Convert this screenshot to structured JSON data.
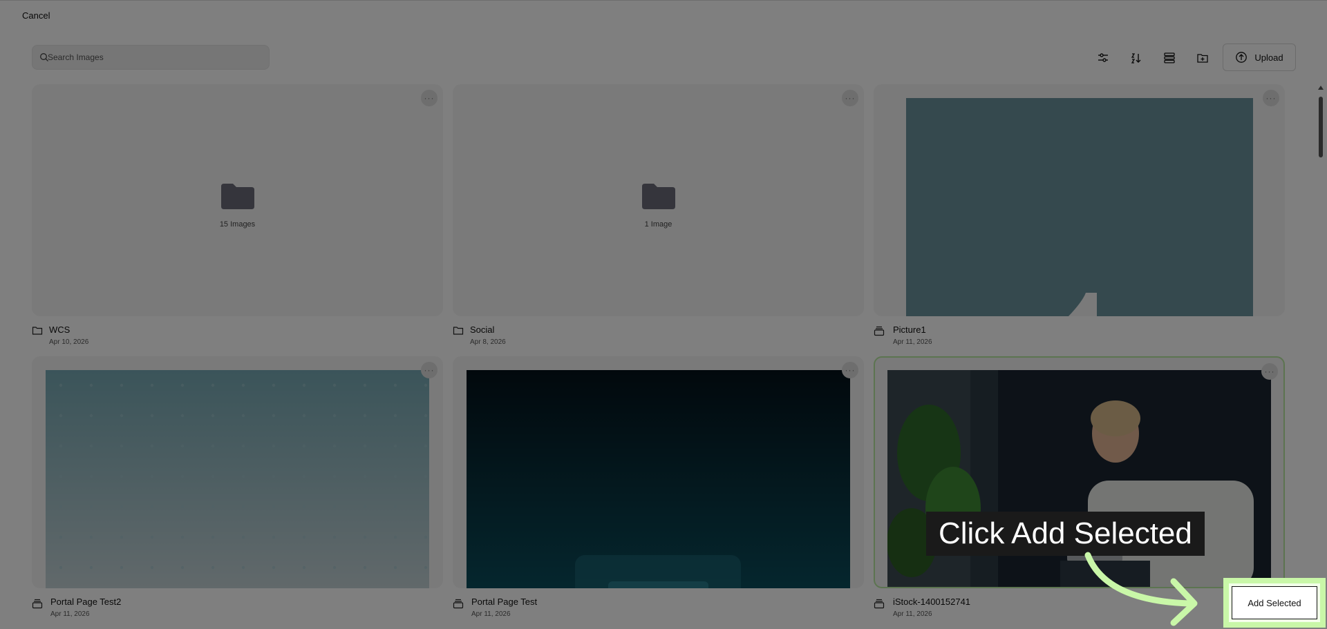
{
  "header": {
    "cancel_label": "Cancel"
  },
  "search": {
    "placeholder": "Search Images"
  },
  "toolbar": {
    "icons": [
      "filter-icon",
      "sort-az-icon",
      "list-view-icon",
      "new-folder-icon"
    ],
    "upload_label": "Upload"
  },
  "items": [
    {
      "type": "folder",
      "name": "WCS",
      "date": "Apr 10, 2026",
      "count": "15 Images"
    },
    {
      "type": "folder",
      "name": "Social",
      "date": "Apr 8, 2026",
      "count": "1 Image"
    },
    {
      "type": "image",
      "name": "Picture1",
      "date": "Apr 11, 2026"
    },
    {
      "type": "image",
      "name": "Portal Page Test2",
      "date": "Apr 11, 2026"
    },
    {
      "type": "image",
      "name": "Portal Page Test",
      "date": "Apr 11, 2026"
    },
    {
      "type": "image",
      "name": "iStock-1400152741",
      "date": "Apr 11, 2026",
      "selected": true
    }
  ],
  "callout": {
    "text": "Click Add Selected"
  },
  "footer": {
    "add_selected_label": "Add Selected"
  },
  "colors": {
    "highlight": "#c9f7a8",
    "selected_border": "#b8e9a0"
  }
}
